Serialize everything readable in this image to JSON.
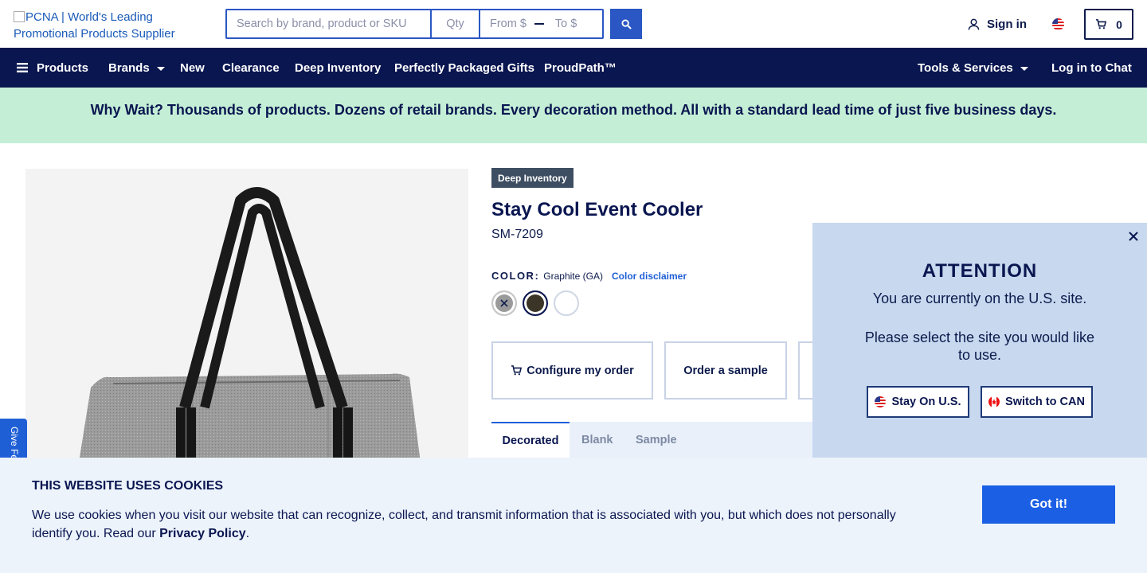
{
  "header": {
    "logo_alt": "PCNA | World's Leading Promotional Products Supplier",
    "search_placeholder": "Search by brand, product or SKU",
    "qty_placeholder": "Qty",
    "price_from_placeholder": "From $",
    "price_to_placeholder": "To $",
    "sign_in_label": "Sign in",
    "cart_count": "0"
  },
  "nav": {
    "products": "Products",
    "brands": "Brands",
    "new": "New",
    "clearance": "Clearance",
    "deep_inventory": "Deep Inventory",
    "gifts": "Perfectly Packaged Gifts",
    "proudpath": "ProudPath™",
    "tools": "Tools & Services",
    "chat": "Log in to Chat"
  },
  "banner": {
    "text": "Why Wait? Thousands of products. Dozens of retail brands. Every decoration method. All with a standard lead time of just five business days."
  },
  "feedback": {
    "label": "Give Fe"
  },
  "product": {
    "badge": "Deep Inventory",
    "title": "Stay Cool Event Cooler",
    "sku": "SM-7209",
    "color_label": "COLOR:",
    "color_value": "Graphite (GA)",
    "color_disclaimer": "Color disclaimer",
    "swatches": [
      {
        "color": "#9a9a9a",
        "state": "unavailable"
      },
      {
        "color": "#3a3526",
        "state": "selected"
      },
      {
        "color": "#ffffff",
        "state": "available"
      }
    ],
    "configure_label": "Configure my order",
    "sample_label": "Order a sample",
    "tabs": [
      "Decorated",
      "Blank",
      "Sample"
    ]
  },
  "modal": {
    "title": "ATTENTION",
    "text1": "You are currently on the U.S. site.",
    "text2": "Please select the site you would like to use.",
    "stay_label": "Stay On U.S.",
    "switch_label": "Switch to CAN"
  },
  "cookie": {
    "title": "THIS WEBSITE USES COOKIES",
    "text": "We use cookies when you visit our website that can recognize, collect, and transmit information that is associated with you, but which does not personally identify you. Read our ",
    "link": "Privacy Policy",
    "period": ".",
    "button": "Got it!"
  }
}
